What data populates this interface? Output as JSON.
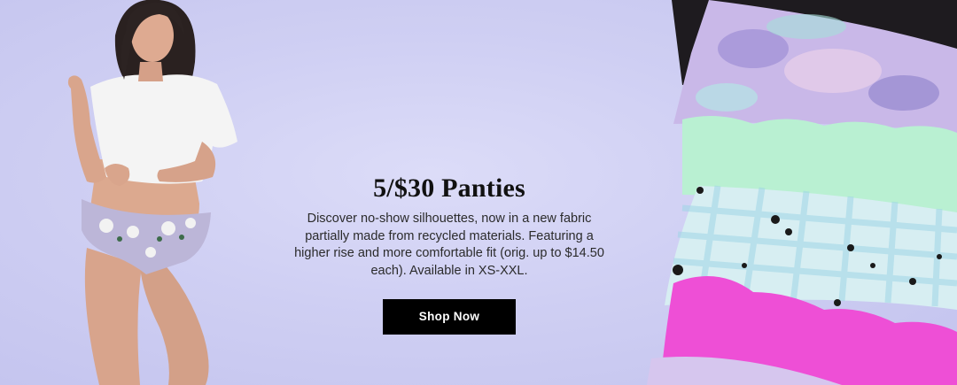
{
  "promo": {
    "headline": "5/$30 Panties",
    "description": "Discover no-show silhouettes, now in a new fabric partially made from recycled materials. Featuring a higher rise and more comfortable fit (orig. up to $14.50 each). Available in XS-XXL.",
    "cta_label": "Shop Now"
  },
  "colors": {
    "background": "#cfcff2",
    "button": "#000000",
    "button_text": "#ffffff",
    "panty_black": "#1e1b1f",
    "panty_tiedye": "#c9b8e8",
    "panty_mint": "#b9f0d2",
    "panty_gingham": "#bfe6ee",
    "panty_pink": "#ee4fd6"
  }
}
